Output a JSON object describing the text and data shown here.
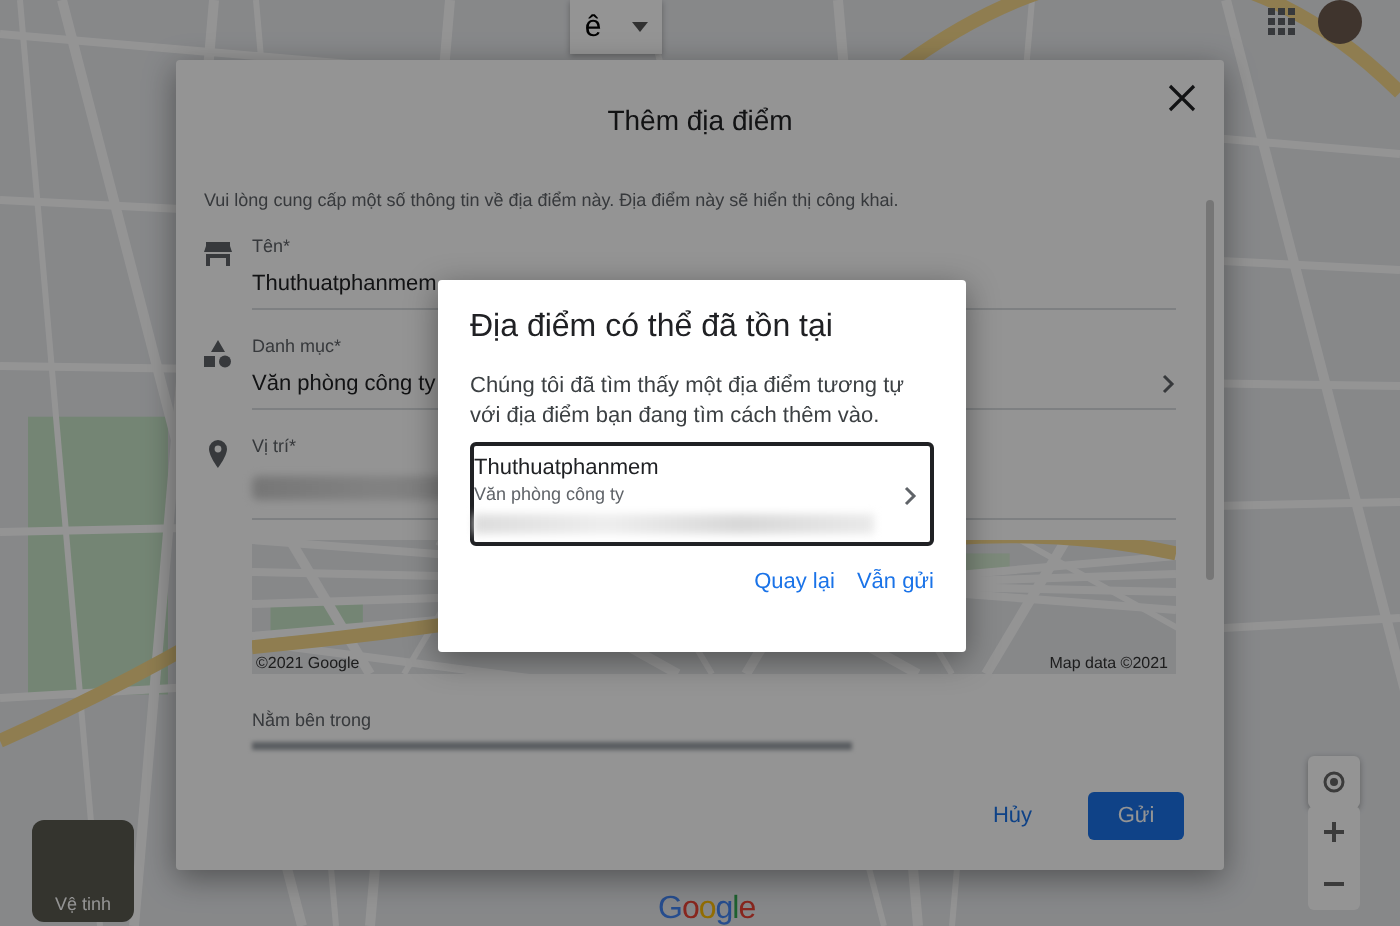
{
  "input_tool": {
    "label": "ê"
  },
  "map_controls": {
    "satellite_label": "Vệ tinh",
    "logo": "Google"
  },
  "add_place_dialog": {
    "title": "Thêm địa điểm",
    "intro": "Vui lòng cung cấp một số thông tin về địa điểm này. Địa điểm này sẽ hiển thị công khai.",
    "fields": [
      {
        "kind": "name",
        "label": "Tên*",
        "value": "Thuthuatphanmem"
      },
      {
        "kind": "category",
        "label": "Danh mục*",
        "value": "Văn phòng công ty"
      },
      {
        "kind": "location",
        "label": "Vị trí*"
      }
    ],
    "map_preview": {
      "copyright": "©2021 Google",
      "attribution": "Map data ©2021"
    },
    "inside_label": "Nằm bên trong",
    "buttons": [
      {
        "kind": "text",
        "label": "Hủy"
      },
      {
        "kind": "primary",
        "label": "Gửi"
      }
    ]
  },
  "duplicate_dialog": {
    "title": "Địa điểm có thể đã tồn tại",
    "message": "Chúng tôi đã tìm thấy một địa điểm tương tự với địa điểm bạn đang tìm cách thêm vào.",
    "match": {
      "name": "Thuthuatphanmem",
      "category": "Văn phòng công ty"
    },
    "buttons": [
      {
        "label": "Quay lại"
      },
      {
        "label": "Vẫn gửi"
      }
    ]
  }
}
